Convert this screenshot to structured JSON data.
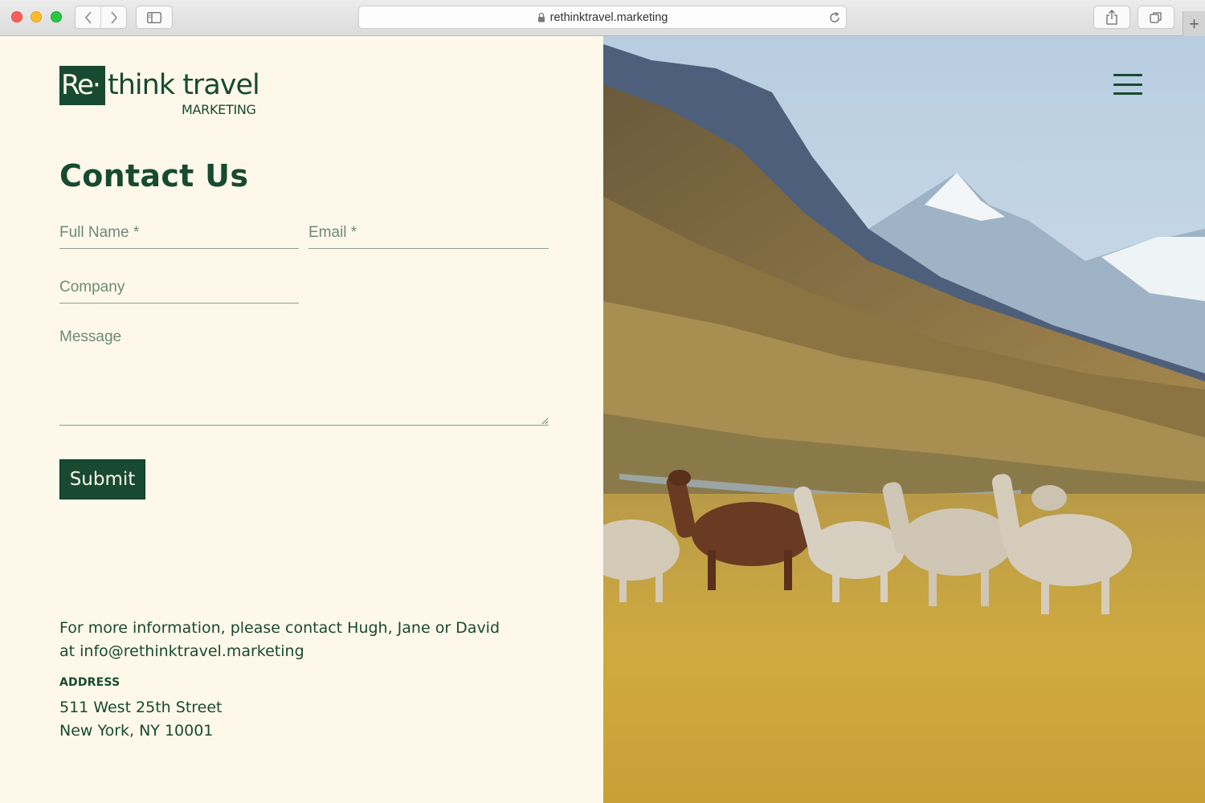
{
  "browser": {
    "url": "rethinktravel.marketing"
  },
  "logo": {
    "mark": "Re·",
    "name": "think travel",
    "tagline": "MARKETING"
  },
  "page": {
    "title": "Contact Us"
  },
  "form": {
    "full_name_placeholder": "Full Name *",
    "email_placeholder": "Email *",
    "company_placeholder": "Company",
    "message_placeholder": "Message",
    "submit_label": "Submit"
  },
  "contact": {
    "info_line1": "For more information, please contact Hugh, Jane or David",
    "info_line2": "at info@rethinktravel.marketing",
    "address_label": "ADDRESS",
    "address_line1": "511 West 25th Street",
    "address_line2": "New York, NY 10001"
  },
  "colors": {
    "brand_green": "#184a31",
    "background_cream": "#fdf8e9"
  },
  "icons": {
    "menu": "hamburger-menu-icon",
    "back": "chevron-left-icon",
    "forward": "chevron-right-icon",
    "lock": "lock-icon",
    "reload": "reload-icon",
    "share": "share-icon",
    "tabs": "tabs-overview-icon",
    "new_tab": "plus-icon"
  }
}
